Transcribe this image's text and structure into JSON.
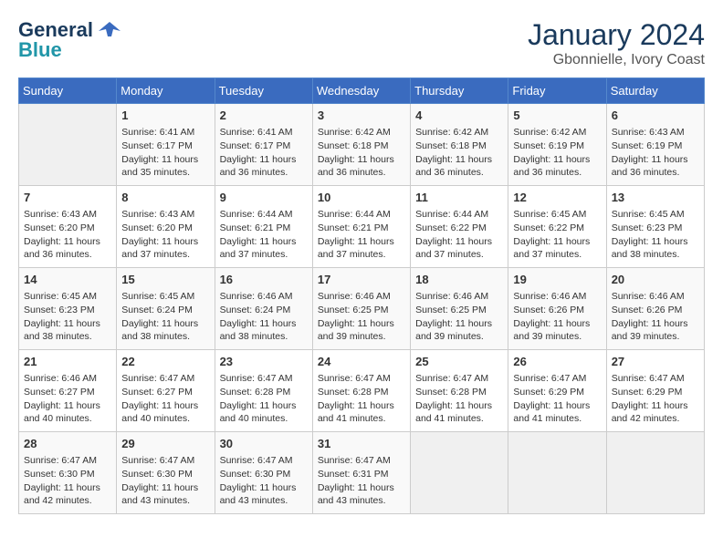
{
  "header": {
    "logo_line1": "General",
    "logo_line2": "Blue",
    "month": "January 2024",
    "location": "Gbonnielle, Ivory Coast"
  },
  "weekdays": [
    "Sunday",
    "Monday",
    "Tuesday",
    "Wednesday",
    "Thursday",
    "Friday",
    "Saturday"
  ],
  "weeks": [
    [
      {
        "day": "",
        "content": ""
      },
      {
        "day": "1",
        "content": "Sunrise: 6:41 AM\nSunset: 6:17 PM\nDaylight: 11 hours\nand 35 minutes."
      },
      {
        "day": "2",
        "content": "Sunrise: 6:41 AM\nSunset: 6:17 PM\nDaylight: 11 hours\nand 36 minutes."
      },
      {
        "day": "3",
        "content": "Sunrise: 6:42 AM\nSunset: 6:18 PM\nDaylight: 11 hours\nand 36 minutes."
      },
      {
        "day": "4",
        "content": "Sunrise: 6:42 AM\nSunset: 6:18 PM\nDaylight: 11 hours\nand 36 minutes."
      },
      {
        "day": "5",
        "content": "Sunrise: 6:42 AM\nSunset: 6:19 PM\nDaylight: 11 hours\nand 36 minutes."
      },
      {
        "day": "6",
        "content": "Sunrise: 6:43 AM\nSunset: 6:19 PM\nDaylight: 11 hours\nand 36 minutes."
      }
    ],
    [
      {
        "day": "7",
        "content": "Sunrise: 6:43 AM\nSunset: 6:20 PM\nDaylight: 11 hours\nand 36 minutes."
      },
      {
        "day": "8",
        "content": "Sunrise: 6:43 AM\nSunset: 6:20 PM\nDaylight: 11 hours\nand 37 minutes."
      },
      {
        "day": "9",
        "content": "Sunrise: 6:44 AM\nSunset: 6:21 PM\nDaylight: 11 hours\nand 37 minutes."
      },
      {
        "day": "10",
        "content": "Sunrise: 6:44 AM\nSunset: 6:21 PM\nDaylight: 11 hours\nand 37 minutes."
      },
      {
        "day": "11",
        "content": "Sunrise: 6:44 AM\nSunset: 6:22 PM\nDaylight: 11 hours\nand 37 minutes."
      },
      {
        "day": "12",
        "content": "Sunrise: 6:45 AM\nSunset: 6:22 PM\nDaylight: 11 hours\nand 37 minutes."
      },
      {
        "day": "13",
        "content": "Sunrise: 6:45 AM\nSunset: 6:23 PM\nDaylight: 11 hours\nand 38 minutes."
      }
    ],
    [
      {
        "day": "14",
        "content": "Sunrise: 6:45 AM\nSunset: 6:23 PM\nDaylight: 11 hours\nand 38 minutes."
      },
      {
        "day": "15",
        "content": "Sunrise: 6:45 AM\nSunset: 6:24 PM\nDaylight: 11 hours\nand 38 minutes."
      },
      {
        "day": "16",
        "content": "Sunrise: 6:46 AM\nSunset: 6:24 PM\nDaylight: 11 hours\nand 38 minutes."
      },
      {
        "day": "17",
        "content": "Sunrise: 6:46 AM\nSunset: 6:25 PM\nDaylight: 11 hours\nand 39 minutes."
      },
      {
        "day": "18",
        "content": "Sunrise: 6:46 AM\nSunset: 6:25 PM\nDaylight: 11 hours\nand 39 minutes."
      },
      {
        "day": "19",
        "content": "Sunrise: 6:46 AM\nSunset: 6:26 PM\nDaylight: 11 hours\nand 39 minutes."
      },
      {
        "day": "20",
        "content": "Sunrise: 6:46 AM\nSunset: 6:26 PM\nDaylight: 11 hours\nand 39 minutes."
      }
    ],
    [
      {
        "day": "21",
        "content": "Sunrise: 6:46 AM\nSunset: 6:27 PM\nDaylight: 11 hours\nand 40 minutes."
      },
      {
        "day": "22",
        "content": "Sunrise: 6:47 AM\nSunset: 6:27 PM\nDaylight: 11 hours\nand 40 minutes."
      },
      {
        "day": "23",
        "content": "Sunrise: 6:47 AM\nSunset: 6:28 PM\nDaylight: 11 hours\nand 40 minutes."
      },
      {
        "day": "24",
        "content": "Sunrise: 6:47 AM\nSunset: 6:28 PM\nDaylight: 11 hours\nand 41 minutes."
      },
      {
        "day": "25",
        "content": "Sunrise: 6:47 AM\nSunset: 6:28 PM\nDaylight: 11 hours\nand 41 minutes."
      },
      {
        "day": "26",
        "content": "Sunrise: 6:47 AM\nSunset: 6:29 PM\nDaylight: 11 hours\nand 41 minutes."
      },
      {
        "day": "27",
        "content": "Sunrise: 6:47 AM\nSunset: 6:29 PM\nDaylight: 11 hours\nand 42 minutes."
      }
    ],
    [
      {
        "day": "28",
        "content": "Sunrise: 6:47 AM\nSunset: 6:30 PM\nDaylight: 11 hours\nand 42 minutes."
      },
      {
        "day": "29",
        "content": "Sunrise: 6:47 AM\nSunset: 6:30 PM\nDaylight: 11 hours\nand 43 minutes."
      },
      {
        "day": "30",
        "content": "Sunrise: 6:47 AM\nSunset: 6:30 PM\nDaylight: 11 hours\nand 43 minutes."
      },
      {
        "day": "31",
        "content": "Sunrise: 6:47 AM\nSunset: 6:31 PM\nDaylight: 11 hours\nand 43 minutes."
      },
      {
        "day": "",
        "content": ""
      },
      {
        "day": "",
        "content": ""
      },
      {
        "day": "",
        "content": ""
      }
    ]
  ]
}
